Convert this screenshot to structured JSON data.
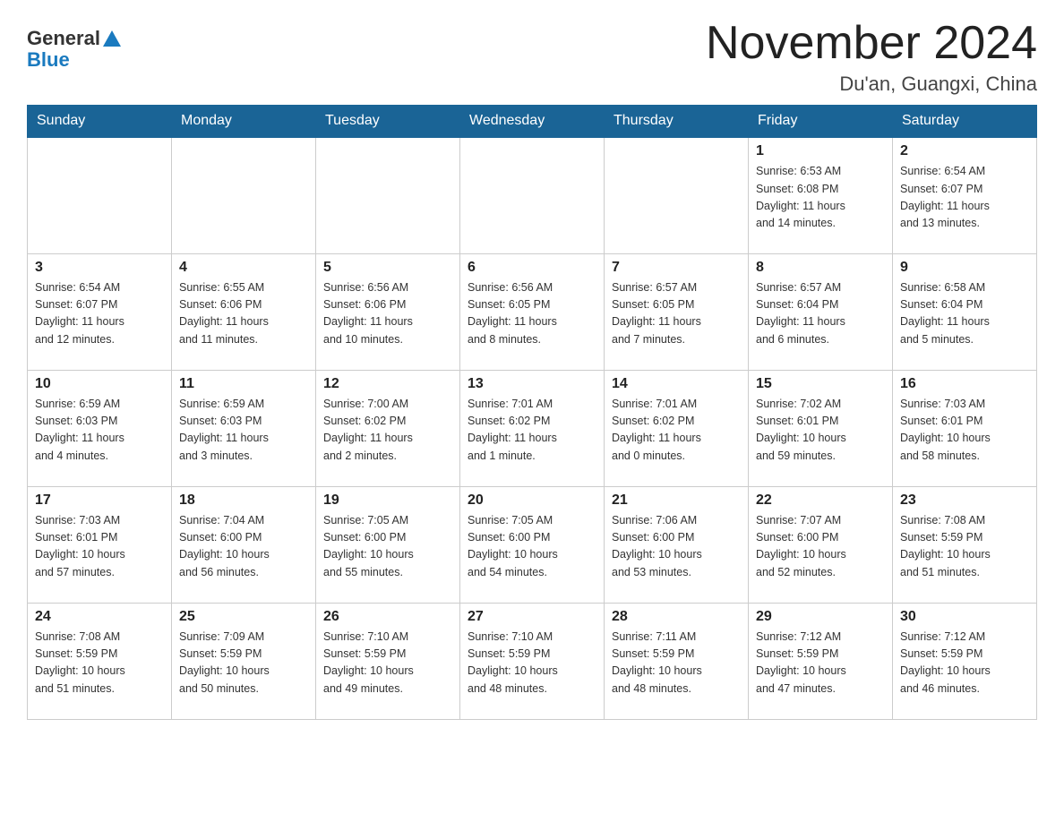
{
  "header": {
    "logo_general": "General",
    "logo_blue": "Blue",
    "month_title": "November 2024",
    "location": "Du'an, Guangxi, China"
  },
  "weekdays": [
    "Sunday",
    "Monday",
    "Tuesday",
    "Wednesday",
    "Thursday",
    "Friday",
    "Saturday"
  ],
  "weeks": [
    [
      {
        "day": "",
        "info": ""
      },
      {
        "day": "",
        "info": ""
      },
      {
        "day": "",
        "info": ""
      },
      {
        "day": "",
        "info": ""
      },
      {
        "day": "",
        "info": ""
      },
      {
        "day": "1",
        "info": "Sunrise: 6:53 AM\nSunset: 6:08 PM\nDaylight: 11 hours\nand 14 minutes."
      },
      {
        "day": "2",
        "info": "Sunrise: 6:54 AM\nSunset: 6:07 PM\nDaylight: 11 hours\nand 13 minutes."
      }
    ],
    [
      {
        "day": "3",
        "info": "Sunrise: 6:54 AM\nSunset: 6:07 PM\nDaylight: 11 hours\nand 12 minutes."
      },
      {
        "day": "4",
        "info": "Sunrise: 6:55 AM\nSunset: 6:06 PM\nDaylight: 11 hours\nand 11 minutes."
      },
      {
        "day": "5",
        "info": "Sunrise: 6:56 AM\nSunset: 6:06 PM\nDaylight: 11 hours\nand 10 minutes."
      },
      {
        "day": "6",
        "info": "Sunrise: 6:56 AM\nSunset: 6:05 PM\nDaylight: 11 hours\nand 8 minutes."
      },
      {
        "day": "7",
        "info": "Sunrise: 6:57 AM\nSunset: 6:05 PM\nDaylight: 11 hours\nand 7 minutes."
      },
      {
        "day": "8",
        "info": "Sunrise: 6:57 AM\nSunset: 6:04 PM\nDaylight: 11 hours\nand 6 minutes."
      },
      {
        "day": "9",
        "info": "Sunrise: 6:58 AM\nSunset: 6:04 PM\nDaylight: 11 hours\nand 5 minutes."
      }
    ],
    [
      {
        "day": "10",
        "info": "Sunrise: 6:59 AM\nSunset: 6:03 PM\nDaylight: 11 hours\nand 4 minutes."
      },
      {
        "day": "11",
        "info": "Sunrise: 6:59 AM\nSunset: 6:03 PM\nDaylight: 11 hours\nand 3 minutes."
      },
      {
        "day": "12",
        "info": "Sunrise: 7:00 AM\nSunset: 6:02 PM\nDaylight: 11 hours\nand 2 minutes."
      },
      {
        "day": "13",
        "info": "Sunrise: 7:01 AM\nSunset: 6:02 PM\nDaylight: 11 hours\nand 1 minute."
      },
      {
        "day": "14",
        "info": "Sunrise: 7:01 AM\nSunset: 6:02 PM\nDaylight: 11 hours\nand 0 minutes."
      },
      {
        "day": "15",
        "info": "Sunrise: 7:02 AM\nSunset: 6:01 PM\nDaylight: 10 hours\nand 59 minutes."
      },
      {
        "day": "16",
        "info": "Sunrise: 7:03 AM\nSunset: 6:01 PM\nDaylight: 10 hours\nand 58 minutes."
      }
    ],
    [
      {
        "day": "17",
        "info": "Sunrise: 7:03 AM\nSunset: 6:01 PM\nDaylight: 10 hours\nand 57 minutes."
      },
      {
        "day": "18",
        "info": "Sunrise: 7:04 AM\nSunset: 6:00 PM\nDaylight: 10 hours\nand 56 minutes."
      },
      {
        "day": "19",
        "info": "Sunrise: 7:05 AM\nSunset: 6:00 PM\nDaylight: 10 hours\nand 55 minutes."
      },
      {
        "day": "20",
        "info": "Sunrise: 7:05 AM\nSunset: 6:00 PM\nDaylight: 10 hours\nand 54 minutes."
      },
      {
        "day": "21",
        "info": "Sunrise: 7:06 AM\nSunset: 6:00 PM\nDaylight: 10 hours\nand 53 minutes."
      },
      {
        "day": "22",
        "info": "Sunrise: 7:07 AM\nSunset: 6:00 PM\nDaylight: 10 hours\nand 52 minutes."
      },
      {
        "day": "23",
        "info": "Sunrise: 7:08 AM\nSunset: 5:59 PM\nDaylight: 10 hours\nand 51 minutes."
      }
    ],
    [
      {
        "day": "24",
        "info": "Sunrise: 7:08 AM\nSunset: 5:59 PM\nDaylight: 10 hours\nand 51 minutes."
      },
      {
        "day": "25",
        "info": "Sunrise: 7:09 AM\nSunset: 5:59 PM\nDaylight: 10 hours\nand 50 minutes."
      },
      {
        "day": "26",
        "info": "Sunrise: 7:10 AM\nSunset: 5:59 PM\nDaylight: 10 hours\nand 49 minutes."
      },
      {
        "day": "27",
        "info": "Sunrise: 7:10 AM\nSunset: 5:59 PM\nDaylight: 10 hours\nand 48 minutes."
      },
      {
        "day": "28",
        "info": "Sunrise: 7:11 AM\nSunset: 5:59 PM\nDaylight: 10 hours\nand 48 minutes."
      },
      {
        "day": "29",
        "info": "Sunrise: 7:12 AM\nSunset: 5:59 PM\nDaylight: 10 hours\nand 47 minutes."
      },
      {
        "day": "30",
        "info": "Sunrise: 7:12 AM\nSunset: 5:59 PM\nDaylight: 10 hours\nand 46 minutes."
      }
    ]
  ]
}
